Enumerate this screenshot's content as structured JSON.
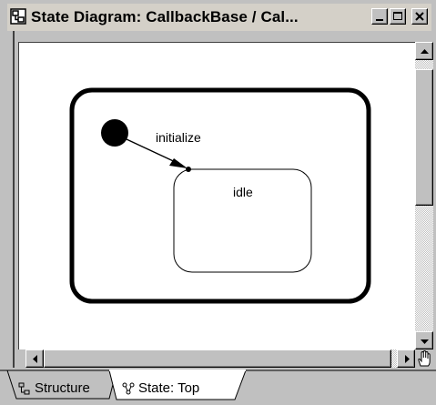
{
  "window": {
    "title": "State Diagram: CallbackBase / Cal...",
    "controls": {
      "minimize": "minimize",
      "maximize": "maximize",
      "close": "close"
    }
  },
  "diagram": {
    "outer_state_label": "",
    "initial_pseudostate": "initial",
    "transition_label": "initialize",
    "state_label": "idle"
  },
  "tabs": [
    {
      "label": "Structure",
      "icon": "structure-icon",
      "active": false
    },
    {
      "label": "State: Top",
      "icon": "state-diagram-icon",
      "active": true
    }
  ],
  "colors": {
    "chrome": "#c0c0c0",
    "canvas": "#ffffff",
    "ink": "#000000"
  }
}
